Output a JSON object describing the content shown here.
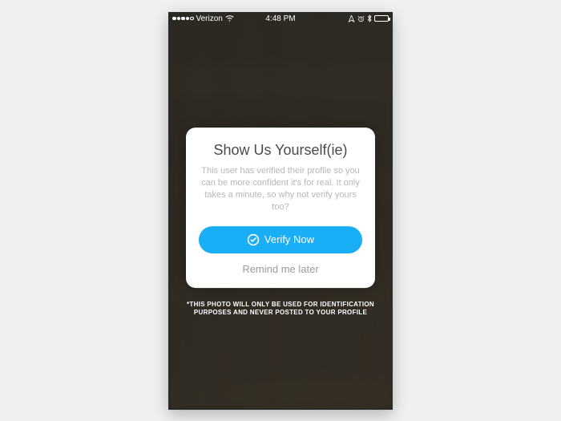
{
  "status_bar": {
    "carrier": "Verizon",
    "time": "4:48 PM"
  },
  "dialog": {
    "title": "Show Us Yourself(ie)",
    "body": "This user has verified their profile so you can be more confident it's for real. It only takes a minute, so why not verify yours too?",
    "primary_label": "Verify Now",
    "secondary_label": "Remind me later"
  },
  "disclaimer": "*THIS PHOTO WILL ONLY BE USED FOR IDENTIFICATION PURPOSES AND NEVER POSTED TO YOUR PROFILE"
}
